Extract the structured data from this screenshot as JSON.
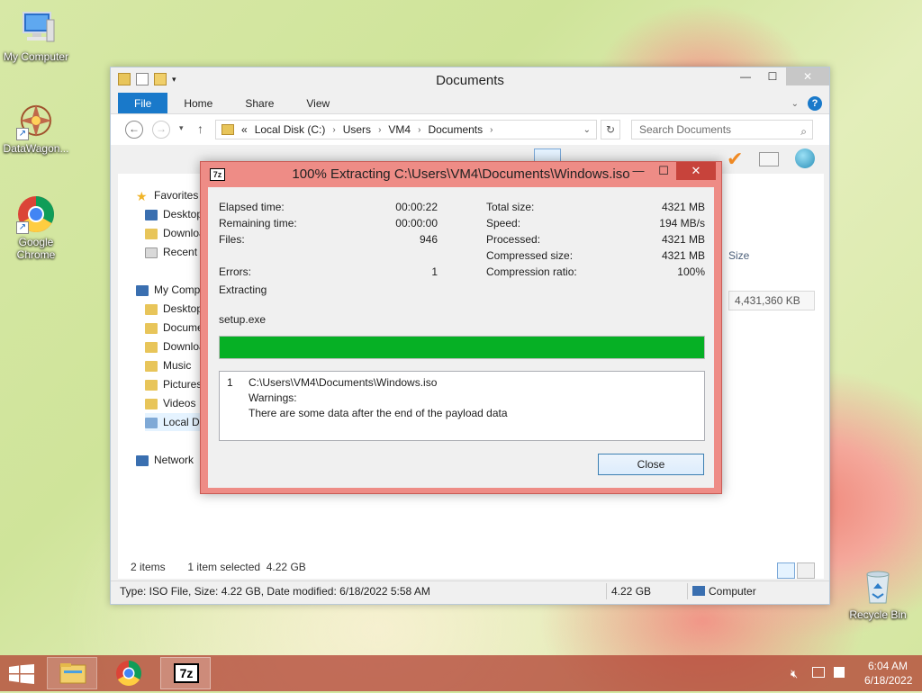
{
  "desktop": {
    "icons": [
      {
        "label": "My Computer"
      },
      {
        "label": "DataWagon..."
      },
      {
        "label": "Google Chrome"
      },
      {
        "label": "Recycle Bin"
      }
    ]
  },
  "explorer": {
    "title": "Documents",
    "tabs": {
      "file": "File",
      "home": "Home",
      "share": "Share",
      "view": "View"
    },
    "address": {
      "prefix": "«",
      "parts": [
        "Local Disk (C:)",
        "Users",
        "VM4",
        "Documents"
      ]
    },
    "search_placeholder": "Search Documents",
    "column_size": "Size",
    "size_value": "4,431,360 KB",
    "nav": {
      "favorites": "Favorites",
      "fav_items": [
        "Desktop",
        "Downloads",
        "Recent places"
      ],
      "computer": "My Computer",
      "computer_items": [
        "Desktop",
        "Documents",
        "Downloads",
        "Music",
        "Pictures",
        "Videos",
        "Local Disk (C:)"
      ],
      "network": "Network"
    },
    "status": {
      "items": "2 items",
      "selected": "1 item selected  4.22 GB"
    },
    "details": {
      "info": "Type: ISO File, Size: 4.22 GB, Date modified: 6/18/2022 5:58 AM",
      "size": "4.22 GB",
      "location": "Computer"
    }
  },
  "dialog": {
    "title": "100% Extracting C:\\Users\\VM4\\Documents\\Windows.iso",
    "logo": "7z",
    "left_labels": {
      "elapsed": "Elapsed time:",
      "remaining": "Remaining time:",
      "files": "Files:",
      "errors": "Errors:"
    },
    "left_values": {
      "elapsed": "00:00:22",
      "remaining": "00:00:00",
      "files": "946",
      "errors": "1"
    },
    "right_labels": {
      "total": "Total size:",
      "speed": "Speed:",
      "processed": "Processed:",
      "compressed": "Compressed size:",
      "ratio": "Compression ratio:"
    },
    "right_values": {
      "total": "4321 MB",
      "speed": "194 MB/s",
      "processed": "4321 MB",
      "compressed": "4321 MB",
      "ratio": "100%"
    },
    "status": "Extracting",
    "current_file": "setup.exe",
    "progress": 1.0,
    "messages": {
      "num": "1",
      "path": "C:\\Users\\VM4\\Documents\\Windows.iso",
      "warnings": "Warnings:",
      "detail": "There are some data after the end of the payload data"
    },
    "close_label": "Close"
  },
  "taskbar": {
    "sevenzip": "7z",
    "time": "6:04 AM",
    "date": "6/18/2022"
  },
  "colors": {
    "progress_fill": "#06b025",
    "dialog_frame": "#ee8c86",
    "ribbon_file": "#1979ca"
  }
}
